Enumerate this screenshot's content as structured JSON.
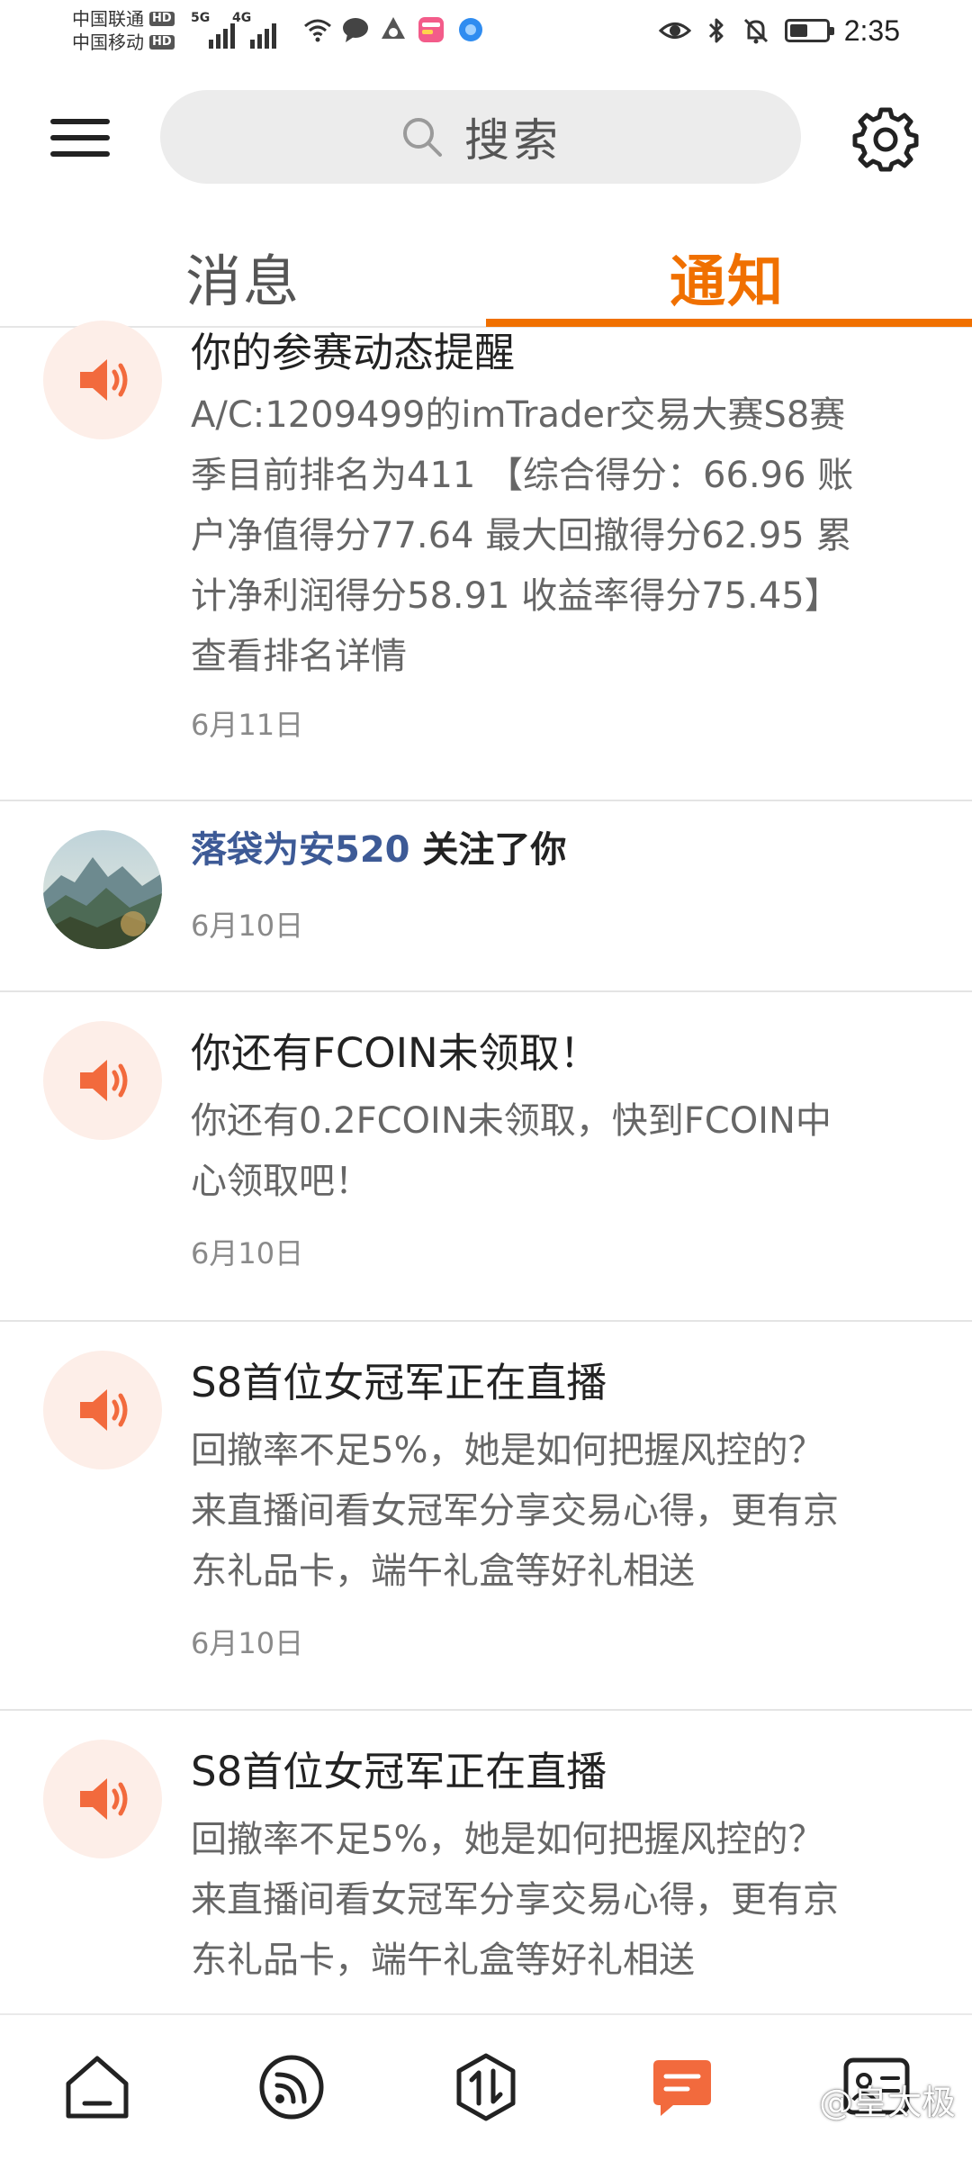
{
  "status_bar": {
    "carrier1": "中国联通",
    "carrier2": "中国移动",
    "hd_label": "HD",
    "net1": "5G",
    "net2": "4G",
    "time": "2:35",
    "battery_level": 0.5
  },
  "header": {
    "search_placeholder": "搜索"
  },
  "tabs": [
    {
      "label": "消息",
      "active": false
    },
    {
      "label": "通知",
      "active": true
    }
  ],
  "colors": {
    "accent": "#f07000",
    "icon_bg": "#fdeee8",
    "link": "#3d5a96"
  },
  "notifications": [
    {
      "type": "announcement",
      "icon": "speaker-icon",
      "title": "你的参赛动态提醒",
      "lines": [
        "A/C:1209499的imTrader交易大赛S8赛",
        "季目前排名为411 【综合得分：66.96 账",
        "户净值得分77.64 最大回撤得分62.95 累",
        "计净利润得分58.91 收益率得分75.45】",
        "查看排名详情"
      ],
      "date": "6月11日"
    },
    {
      "type": "follow",
      "icon": "avatar",
      "user": "落袋为安520",
      "action": " 关注了你",
      "date": "6月10日"
    },
    {
      "type": "announcement",
      "icon": "speaker-icon",
      "title": "你还有FCOIN未领取！",
      "lines": [
        "你还有0.2FCOIN未领取，快到FCOIN中",
        "心领取吧！"
      ],
      "date": "6月10日"
    },
    {
      "type": "announcement",
      "icon": "speaker-icon",
      "title": "S8首位女冠军正在直播",
      "lines": [
        "回撤率不足5%，她是如何把握风控的？",
        "来直播间看女冠军分享交易心得，更有京",
        "东礼品卡，端午礼盒等好礼相送"
      ],
      "date": "6月10日"
    },
    {
      "type": "announcement",
      "icon": "speaker-icon",
      "title": "S8首位女冠军正在直播",
      "lines": [
        "回撤率不足5%，她是如何把握风控的？",
        "来直播间看女冠军分享交易心得，更有京",
        "东礼品卡，端午礼盒等好礼相送"
      ]
    }
  ],
  "bottom_nav": [
    {
      "name": "home-icon",
      "active": false
    },
    {
      "name": "feed-icon",
      "active": false
    },
    {
      "name": "trade-icon",
      "active": false
    },
    {
      "name": "messages-icon",
      "active": true
    },
    {
      "name": "profile-card-icon",
      "active": false
    }
  ],
  "watermark": "@皇太极"
}
